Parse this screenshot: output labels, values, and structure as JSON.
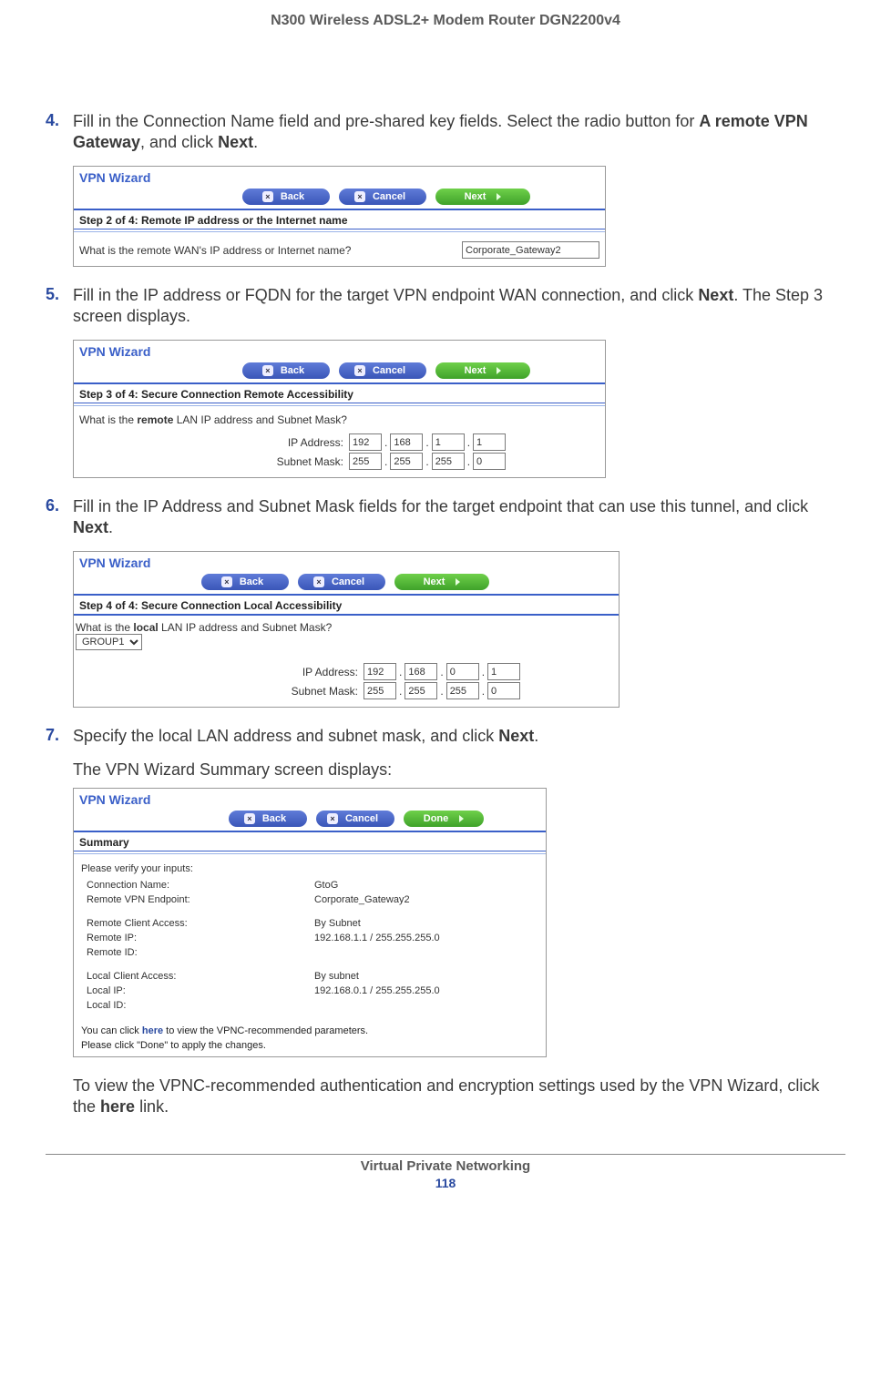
{
  "doc": {
    "title": "N300 Wireless ADSL2+ Modem Router DGN2200v4",
    "footer_section": "Virtual Private Networking",
    "page_number": "118"
  },
  "steps": {
    "s4": {
      "num": "4.",
      "text_a": "Fill in the Connection Name field and pre-shared key fields. Select the radio button for ",
      "text_b": "A remote VPN Gateway",
      "text_c": ", and click ",
      "text_d": "Next",
      "text_e": "."
    },
    "s5": {
      "num": "5.",
      "text_a": "Fill in the IP address or FQDN for the target VPN endpoint WAN connection, and click ",
      "text_b": "Next",
      "text_c": ". The Step 3 screen displays."
    },
    "s6": {
      "num": "6.",
      "text_a": "Fill in the IP Address and Subnet Mask fields for the target endpoint that can use this tunnel, and click ",
      "text_b": "Next",
      "text_c": "."
    },
    "s7": {
      "num": "7.",
      "text_a": "Specify the local LAN address and subnet mask, and click ",
      "text_b": "Next",
      "text_c": ".",
      "followup": "The VPN Wizard Summary screen displays:"
    },
    "closing": {
      "text_a": "To view the VPNC-recommended authentication and encryption settings used by the VPN Wizard, click the ",
      "text_b": "here",
      "text_c": " link."
    }
  },
  "wizard_common": {
    "title": "VPN Wizard",
    "back": "Back",
    "cancel": "Cancel",
    "next": "Next",
    "done": "Done"
  },
  "wiz2": {
    "step_label": "Step 2 of 4: Remote IP address or the Internet name",
    "question": "What is the remote WAN's IP address or Internet name?",
    "value": "Corporate_Gateway2"
  },
  "wiz3": {
    "step_label": "Step 3 of 4: Secure Connection Remote Accessibility",
    "question_a": "What is the ",
    "question_b": "remote",
    "question_c": " LAN IP address and Subnet Mask?",
    "ip_label": "IP Address:",
    "mask_label": "Subnet Mask:",
    "ip": [
      "192",
      "168",
      "1",
      "1"
    ],
    "mask": [
      "255",
      "255",
      "255",
      "0"
    ]
  },
  "wiz4": {
    "step_label": "Step 4 of 4: Secure Connection Local Accessibility",
    "question_a": "What is the ",
    "question_b": "local",
    "question_c": " LAN IP address and Subnet Mask?",
    "group": "GROUP1",
    "ip_label": "IP Address:",
    "mask_label": "Subnet Mask:",
    "ip": [
      "192",
      "168",
      "0",
      "1"
    ],
    "mask": [
      "255",
      "255",
      "255",
      "0"
    ]
  },
  "summary": {
    "heading": "Summary",
    "verify": "Please verify your inputs:",
    "rows": {
      "conn_name_l": "Connection Name:",
      "conn_name_v": "GtoG",
      "endpoint_l": "Remote VPN Endpoint:",
      "endpoint_v": "Corporate_Gateway2",
      "rclient_l": "Remote Client Access:",
      "rclient_v": "By Subnet",
      "rip_l": "Remote IP:",
      "rip_v": "192.168.1.1 / 255.255.255.0",
      "rid_l": "Remote ID:",
      "rid_v": "",
      "lclient_l": "Local Client Access:",
      "lclient_v": "By subnet",
      "lip_l": "Local IP:",
      "lip_v": "192.168.0.1 / 255.255.255.0",
      "lid_l": "Local ID:",
      "lid_v": ""
    },
    "note1_a": "You can click ",
    "note1_b": "here",
    "note1_c": " to view the VPNC-recommended parameters.",
    "note2": "Please click \"Done\" to apply the changes."
  }
}
